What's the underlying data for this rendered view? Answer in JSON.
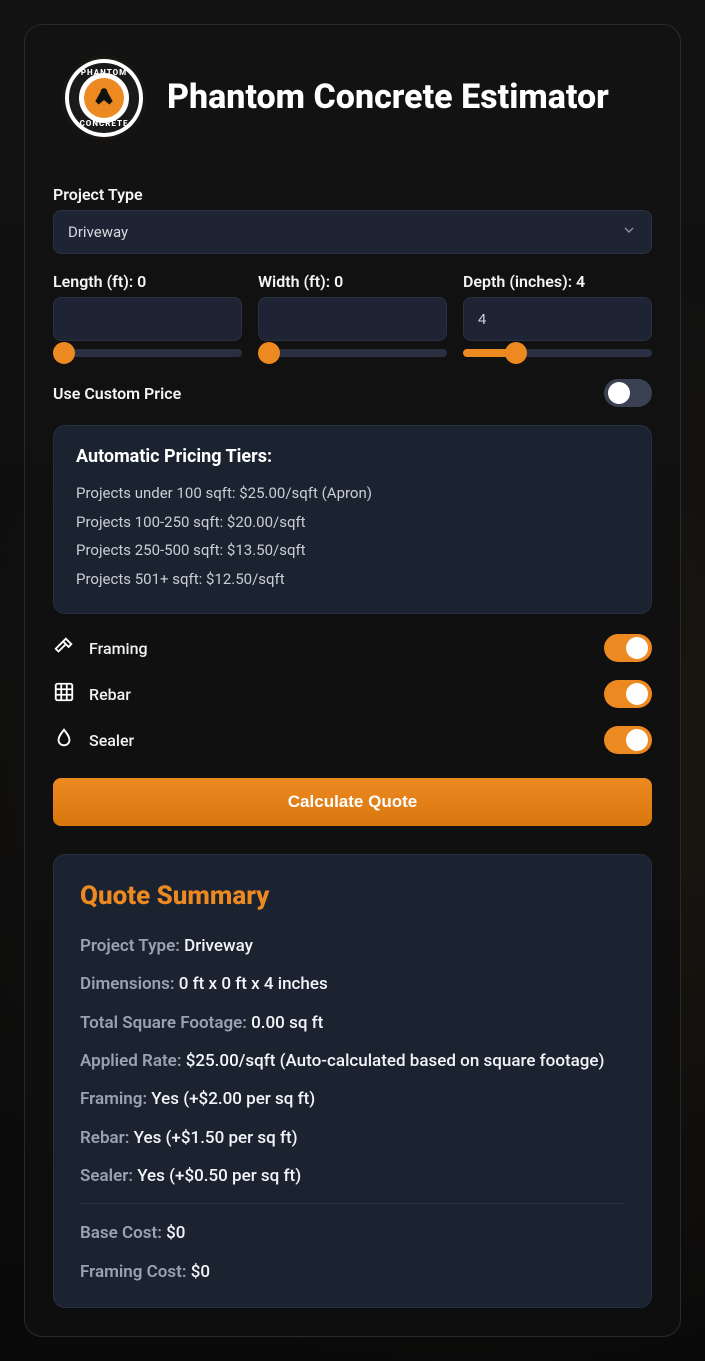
{
  "header": {
    "title": "Phantom Concrete Estimator",
    "logo_top": "PHANTOM",
    "logo_bottom": "CONCRETE"
  },
  "projectType": {
    "label": "Project Type",
    "value": "Driveway"
  },
  "dims": {
    "length": {
      "label": "Length (ft): 0",
      "value": ""
    },
    "width": {
      "label": "Width (ft): 0",
      "value": ""
    },
    "depth": {
      "label": "Depth (inches): 4",
      "value": "4"
    }
  },
  "customPrice": {
    "label": "Use Custom Price",
    "enabled": false
  },
  "tiers": {
    "title": "Automatic Pricing Tiers:",
    "lines": [
      "Projects under 100 sqft: $25.00/sqft (Apron)",
      "Projects 100-250 sqft: $20.00/sqft",
      "Projects 250-500 sqft: $13.50/sqft",
      "Projects 501+ sqft: $12.50/sqft"
    ]
  },
  "options": {
    "framing": {
      "label": "Framing",
      "on": true
    },
    "rebar": {
      "label": "Rebar",
      "on": true
    },
    "sealer": {
      "label": "Sealer",
      "on": true
    }
  },
  "calcButton": "Calculate Quote",
  "summary": {
    "title": "Quote Summary",
    "rows": [
      {
        "lab": "Project Type:",
        "val": " Driveway"
      },
      {
        "lab": "Dimensions:",
        "val": " 0 ft x 0 ft x 4 inches"
      },
      {
        "lab": "Total Square Footage:",
        "val": " 0.00 sq ft"
      },
      {
        "lab": "Applied Rate:",
        "val": " $25.00/sqft (Auto-calculated based on square footage)"
      },
      {
        "lab": "Framing:",
        "val": " Yes (+$2.00 per sq ft)"
      },
      {
        "lab": "Rebar:",
        "val": " Yes (+$1.50 per sq ft)"
      },
      {
        "lab": "Sealer:",
        "val": " Yes (+$0.50 per sq ft)"
      }
    ],
    "costs": [
      {
        "lab": "Base Cost:",
        "val": " $0"
      },
      {
        "lab": "Framing Cost:",
        "val": " $0"
      }
    ]
  }
}
